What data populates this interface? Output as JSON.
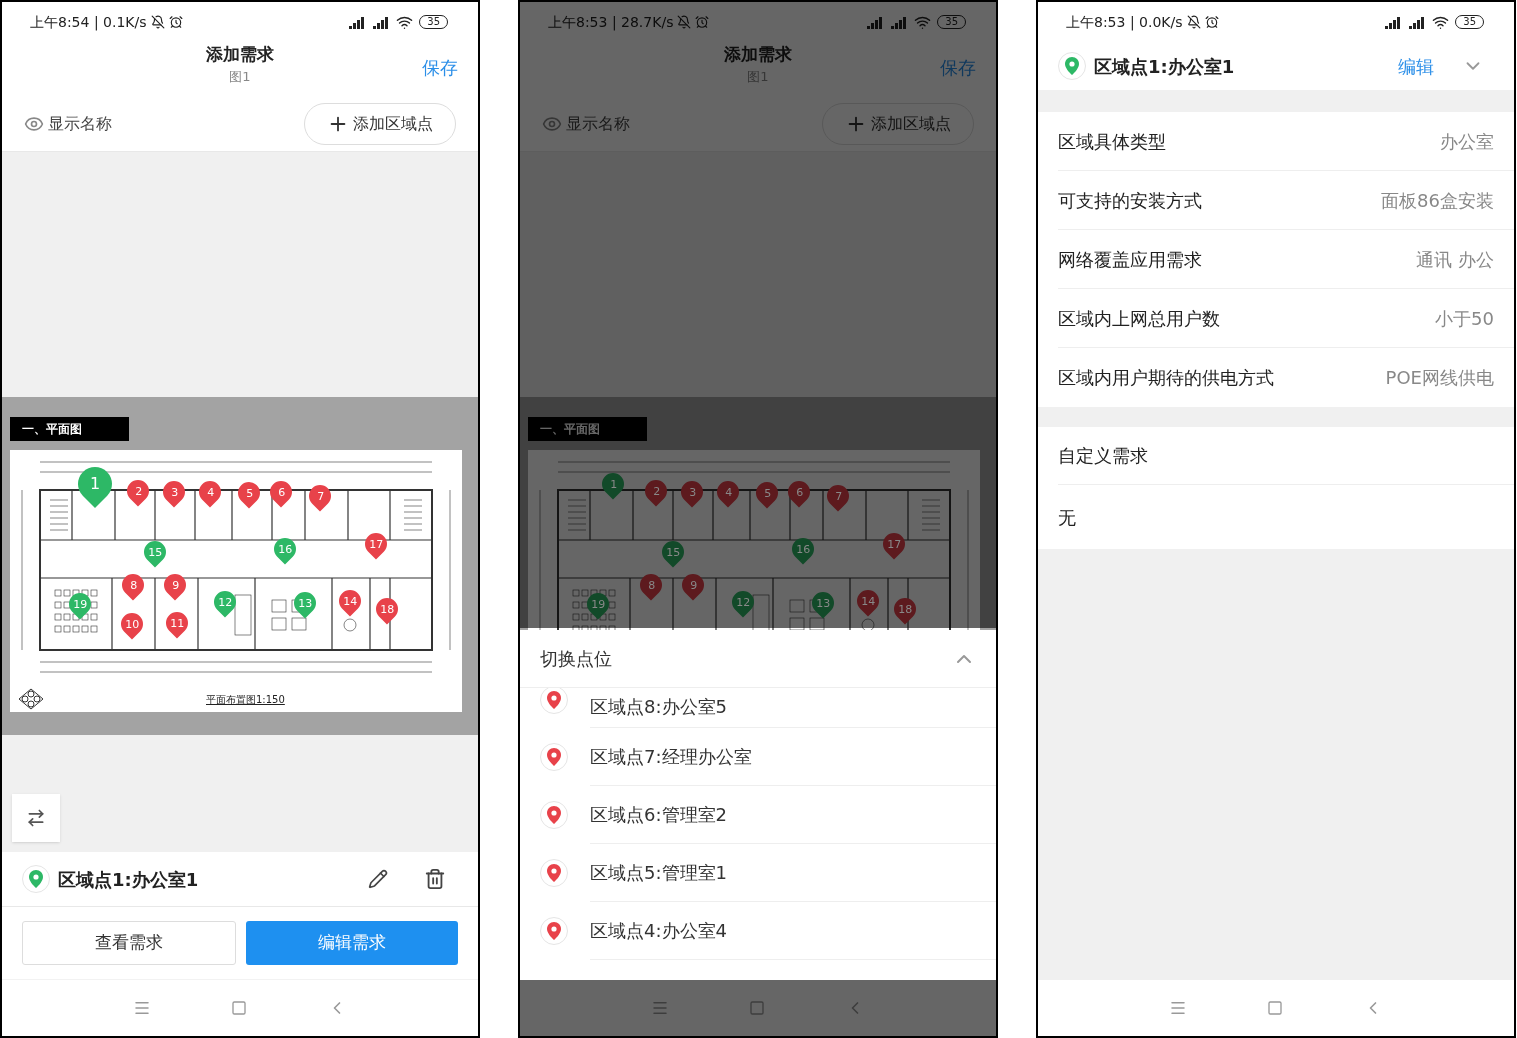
{
  "phone_1": {
    "status": {
      "time": "上午8:54 | 0.1K/s",
      "battery": "35"
    },
    "header": {
      "title": "添加需求",
      "subtitle": "图1",
      "save": "保存"
    },
    "toolbar": {
      "show_names": "显示名称",
      "add_point": "添加区域点"
    },
    "map": {
      "label": "一、平面图",
      "caption": "平面布置图1:150",
      "pins": [
        {
          "number": "1",
          "color": "#2db866",
          "selected": true
        },
        {
          "number": "2",
          "color": "#e8424a",
          "selected": false
        },
        {
          "number": "3",
          "color": "#e8424a",
          "selected": false
        },
        {
          "number": "4",
          "color": "#e8424a",
          "selected": false
        },
        {
          "number": "5",
          "color": "#e8424a",
          "selected": false
        },
        {
          "number": "6",
          "color": "#e8424a",
          "selected": false
        },
        {
          "number": "7",
          "color": "#e8424a",
          "selected": false
        },
        {
          "number": "8",
          "color": "#e8424a",
          "selected": false
        },
        {
          "number": "9",
          "color": "#e8424a",
          "selected": false
        },
        {
          "number": "10",
          "color": "#e8424a",
          "selected": false
        },
        {
          "number": "11",
          "color": "#e8424a",
          "selected": false
        },
        {
          "number": "12",
          "color": "#2db866",
          "selected": false
        },
        {
          "number": "13",
          "color": "#2db866",
          "selected": false
        },
        {
          "number": "14",
          "color": "#e8424a",
          "selected": false
        },
        {
          "number": "15",
          "color": "#2db866",
          "selected": false
        },
        {
          "number": "16",
          "color": "#2db866",
          "selected": false
        },
        {
          "number": "17",
          "color": "#e8424a",
          "selected": false
        },
        {
          "number": "18",
          "color": "#e8424a",
          "selected": false
        },
        {
          "number": "19",
          "color": "#2db866",
          "selected": false
        }
      ]
    },
    "selected_point": {
      "name": "区域点1:办公室1",
      "color": "#2db866"
    },
    "buttons": [
      {
        "label": "查看需求",
        "kind": "secondary"
      },
      {
        "label": "编辑需求",
        "kind": "primary"
      }
    ]
  },
  "phone_2": {
    "status": {
      "time": "上午8:53 | 28.7K/s",
      "battery": "35"
    },
    "header": {
      "title": "添加需求",
      "subtitle": "图1",
      "save": "保存"
    },
    "toolbar": {
      "show_names": "显示名称",
      "add_point": "添加区域点"
    },
    "map": {
      "label": "一、平面图",
      "pins": [
        {
          "number": "1",
          "color": "#124a29",
          "selected": false
        },
        {
          "number": "2",
          "color": "#5d1a1e",
          "selected": false
        },
        {
          "number": "3",
          "color": "#5d1a1e",
          "selected": false
        },
        {
          "number": "4",
          "color": "#5d1a1e",
          "selected": false
        },
        {
          "number": "5",
          "color": "#5d1a1e",
          "selected": false
        },
        {
          "number": "6",
          "color": "#5d1a1e",
          "selected": false
        },
        {
          "number": "7",
          "color": "#5d1a1e",
          "selected": false
        },
        {
          "number": "8",
          "color": "#5d1a1e",
          "selected": false
        },
        {
          "number": "9",
          "color": "#5d1a1e",
          "selected": false
        },
        {
          "number": "12",
          "color": "#124a29",
          "selected": false
        },
        {
          "number": "13",
          "color": "#124a29",
          "selected": false
        },
        {
          "number": "14",
          "color": "#5d1a1e",
          "selected": false
        },
        {
          "number": "15",
          "color": "#124a29",
          "selected": false
        },
        {
          "number": "16",
          "color": "#124a29",
          "selected": false
        },
        {
          "number": "17",
          "color": "#5d1a1e",
          "selected": false
        },
        {
          "number": "18",
          "color": "#5d1a1e",
          "selected": false
        },
        {
          "number": "19",
          "color": "#124a29",
          "selected": false
        }
      ]
    },
    "sheet": {
      "title": "切换点位",
      "items": [
        {
          "name": "区域点8:办公室5",
          "color": "#e8424a"
        },
        {
          "name": "区域点7:经理办公室",
          "color": "#e8424a"
        },
        {
          "name": "区域点6:管理室2",
          "color": "#e8424a"
        },
        {
          "name": "区域点5:管理室1",
          "color": "#e8424a"
        },
        {
          "name": "区域点4:办公室4",
          "color": "#e8424a"
        }
      ]
    }
  },
  "phone_3": {
    "status": {
      "time": "上午8:53 | 0.0K/s",
      "battery": "35"
    },
    "point": {
      "name": "区域点1:办公室1",
      "color": "#2db866",
      "edit": "编辑"
    },
    "requirements": [
      {
        "label": "区域具体类型",
        "value": "办公室"
      },
      {
        "label": "可支持的安装方式",
        "value": "面板86盒安装"
      },
      {
        "label": "网络覆盖应用需求",
        "value": "通讯 办公"
      },
      {
        "label": "区域内上网总用户数",
        "value": "小于50"
      },
      {
        "label": "区域内用户期待的供电方式",
        "value": "POE网线供电"
      }
    ],
    "custom": {
      "title": "自定义需求",
      "value": "无"
    }
  }
}
